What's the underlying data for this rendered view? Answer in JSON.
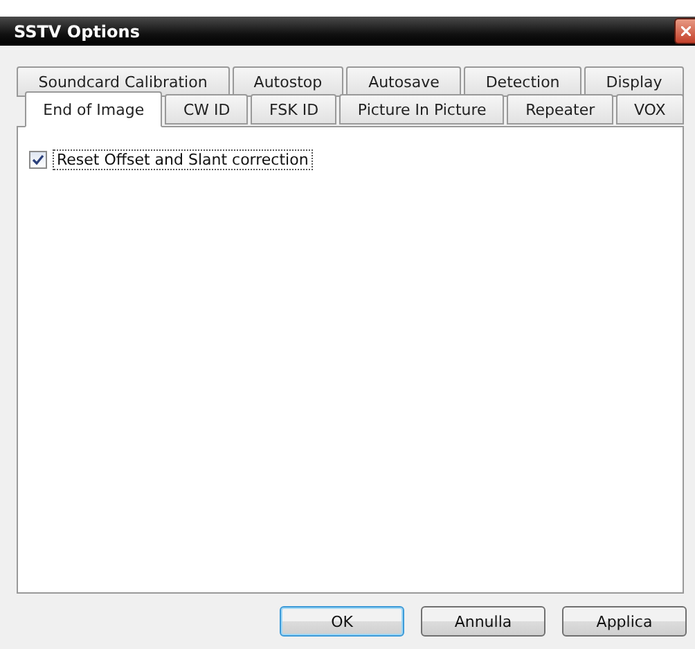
{
  "window": {
    "title": "SSTV Options"
  },
  "tab_rows": [
    [
      {
        "label": "Soundcard Calibration",
        "selected": false
      },
      {
        "label": "Autostop",
        "selected": false
      },
      {
        "label": "Autosave",
        "selected": false
      },
      {
        "label": "Detection",
        "selected": false
      },
      {
        "label": "Display",
        "selected": false
      }
    ],
    [
      {
        "label": "End of Image",
        "selected": true
      },
      {
        "label": "CW ID",
        "selected": false
      },
      {
        "label": "FSK ID",
        "selected": false
      },
      {
        "label": "Picture In Picture",
        "selected": false
      },
      {
        "label": "Repeater",
        "selected": false
      },
      {
        "label": "VOX",
        "selected": false
      }
    ]
  ],
  "checkbox": {
    "label": "Reset Offset and Slant correction",
    "checked": true
  },
  "buttons": [
    {
      "label": "OK",
      "default": true
    },
    {
      "label": "Annulla",
      "default": false
    },
    {
      "label": "Applica",
      "default": false
    }
  ]
}
